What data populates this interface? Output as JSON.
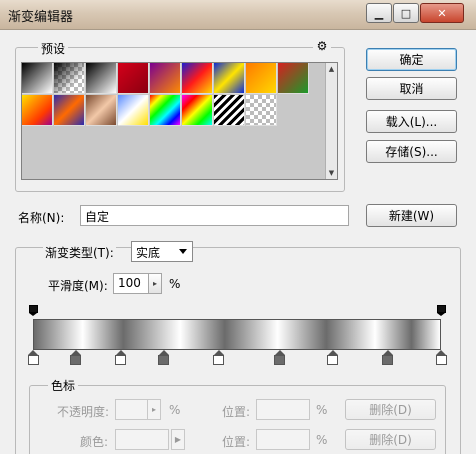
{
  "window": {
    "title": "渐变编辑器",
    "minimize": "▁",
    "maximize": "□",
    "close": "✕"
  },
  "presets": {
    "label": "预设",
    "menu_icon": "gear-icon",
    "swatches": [
      {
        "kind": "linear",
        "colors": [
          "#000000",
          "#ffffff"
        ]
      },
      {
        "kind": "checker-fade",
        "colors": [
          "#000000",
          "transparent"
        ]
      },
      {
        "kind": "linear",
        "colors": [
          "#000000",
          "#ffffff"
        ]
      },
      {
        "kind": "linear",
        "colors": [
          "#d4001a",
          "#8a0010"
        ]
      },
      {
        "kind": "linear",
        "colors": [
          "#7a0090",
          "#ff8c00"
        ]
      },
      {
        "kind": "linear",
        "colors": [
          "#1c1ccf",
          "#ff1a1a",
          "#ffd800"
        ]
      },
      {
        "kind": "linear",
        "colors": [
          "#0a2ad8",
          "#ffe400",
          "#0a2ad8"
        ]
      },
      {
        "kind": "linear",
        "colors": [
          "#ff7a00",
          "#ffd800"
        ]
      },
      {
        "kind": "linear",
        "colors": [
          "#d62020",
          "#1a9a2a"
        ]
      },
      {
        "kind": "linear",
        "colors": [
          "#ffe000",
          "#ff8c00",
          "#ff3a00",
          "#9a0090"
        ]
      },
      {
        "kind": "linear",
        "colors": [
          "#2a2ab0",
          "#ff6a00",
          "#2a2ab0"
        ]
      },
      {
        "kind": "linear",
        "colors": [
          "#7a4a30",
          "#f2c8a8",
          "#7a4a30"
        ]
      },
      {
        "kind": "linear",
        "colors": [
          "#5a8cff",
          "#ffffff",
          "#ffe000"
        ]
      },
      {
        "kind": "rainbow",
        "colors": [
          "#ff0000",
          "#ffff00",
          "#00ff00",
          "#00ffff",
          "#0000ff",
          "#ff00ff"
        ]
      },
      {
        "kind": "rainbow",
        "colors": [
          "#ff00ff",
          "#ff0000",
          "#ffff00",
          "#00ff00",
          "#00ffff"
        ]
      },
      {
        "kind": "stripes",
        "colors": [
          "#000000",
          "#ffffff"
        ]
      },
      {
        "kind": "checker",
        "colors": []
      }
    ]
  },
  "buttons": {
    "ok": "确定",
    "cancel": "取消",
    "load": "载入(L)...",
    "save": "存储(S)...",
    "new": "新建(W)"
  },
  "name_row": {
    "label": "名称(N):",
    "value": "自定"
  },
  "gradient": {
    "type_label": "渐变类型(T):",
    "type_value": "实底",
    "smoothness_label": "平滑度(M):",
    "smoothness_value": "100",
    "smoothness_unit": "%",
    "opacity_stops": [
      0,
      100
    ],
    "color_stops": [
      {
        "pos": 0,
        "color": "#ffffff"
      },
      {
        "pos": 10.5,
        "color": "#6b6b6b"
      },
      {
        "pos": 21.5,
        "color": "#ffffff"
      },
      {
        "pos": 32,
        "color": "#6b6b6b"
      },
      {
        "pos": 45.5,
        "color": "#ffffff"
      },
      {
        "pos": 60.5,
        "color": "#6b6b6b"
      },
      {
        "pos": 73.5,
        "color": "#ffffff"
      },
      {
        "pos": 87,
        "color": "#6b6b6b"
      },
      {
        "pos": 100,
        "color": "#ffffff"
      }
    ]
  },
  "stops": {
    "label": "色标",
    "opacity_label": "不透明度:",
    "opacity_unit": "%",
    "location_label": "位置:",
    "location_unit": "%",
    "delete_label": "删除(D)",
    "color_label": "颜色:",
    "location2_label": "位置:",
    "location2_unit": "%",
    "delete2_label": "删除(D)"
  }
}
